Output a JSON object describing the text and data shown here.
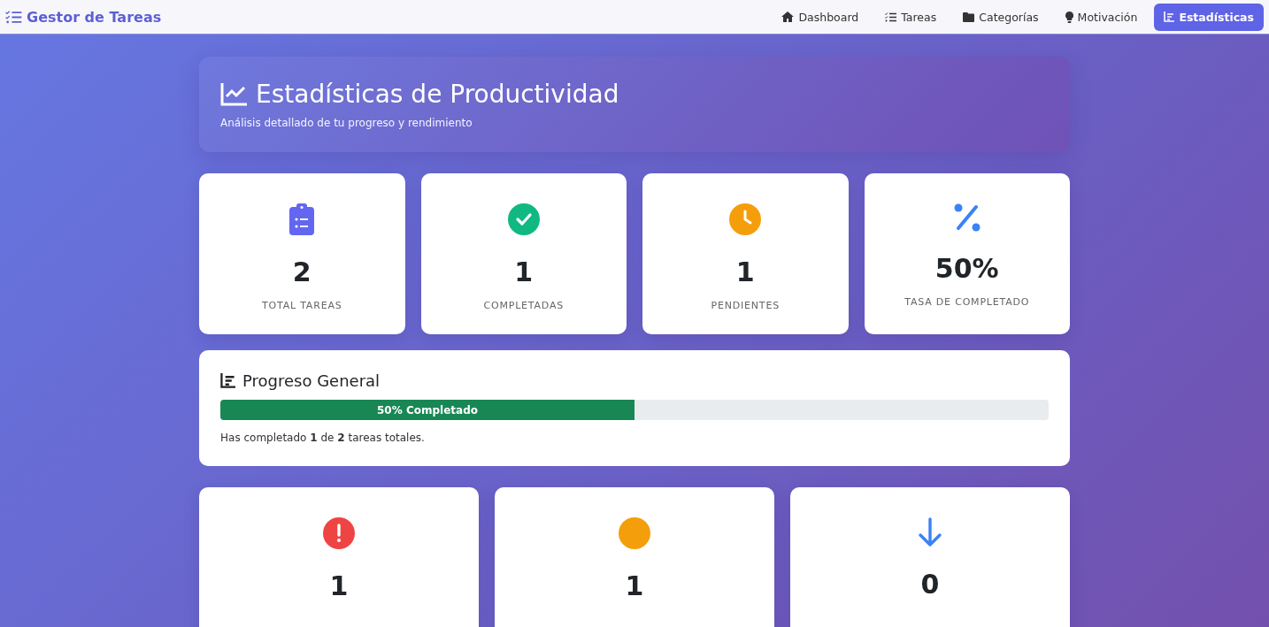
{
  "navbar": {
    "brand": "Gestor de Tareas",
    "items": [
      {
        "label": "Dashboard",
        "kind": "home",
        "selected": false
      },
      {
        "label": "Tareas",
        "kind": "tasks",
        "selected": false
      },
      {
        "label": "Categorías",
        "kind": "folder",
        "selected": false
      },
      {
        "label": "Motivación",
        "kind": "bulb",
        "selected": false
      },
      {
        "label": "Estadísticas",
        "kind": "stats",
        "selected": true
      }
    ]
  },
  "header": {
    "title": "Estadísticas de Productividad",
    "subtitle": "Análisis detallado de tu progreso y rendimiento"
  },
  "stats": [
    {
      "kind": "clipboard",
      "value": "2",
      "label": "TOTAL TAREAS"
    },
    {
      "kind": "check",
      "value": "1",
      "label": "COMPLETADAS"
    },
    {
      "kind": "clock",
      "value": "1",
      "label": "PENDIENTES"
    },
    {
      "kind": "percent",
      "value": "50%",
      "label": "TASA DE COMPLETADO"
    }
  ],
  "progress": {
    "title": "Progreso General",
    "level": 0.5,
    "bar_label": "50% Completado",
    "summary": "Has completado **1** de **2** tareas totales."
  },
  "priorities": [
    {
      "kind": "high",
      "value": "1"
    },
    {
      "kind": "medium",
      "value": "1"
    },
    {
      "kind": "low",
      "value": "0"
    }
  ]
}
